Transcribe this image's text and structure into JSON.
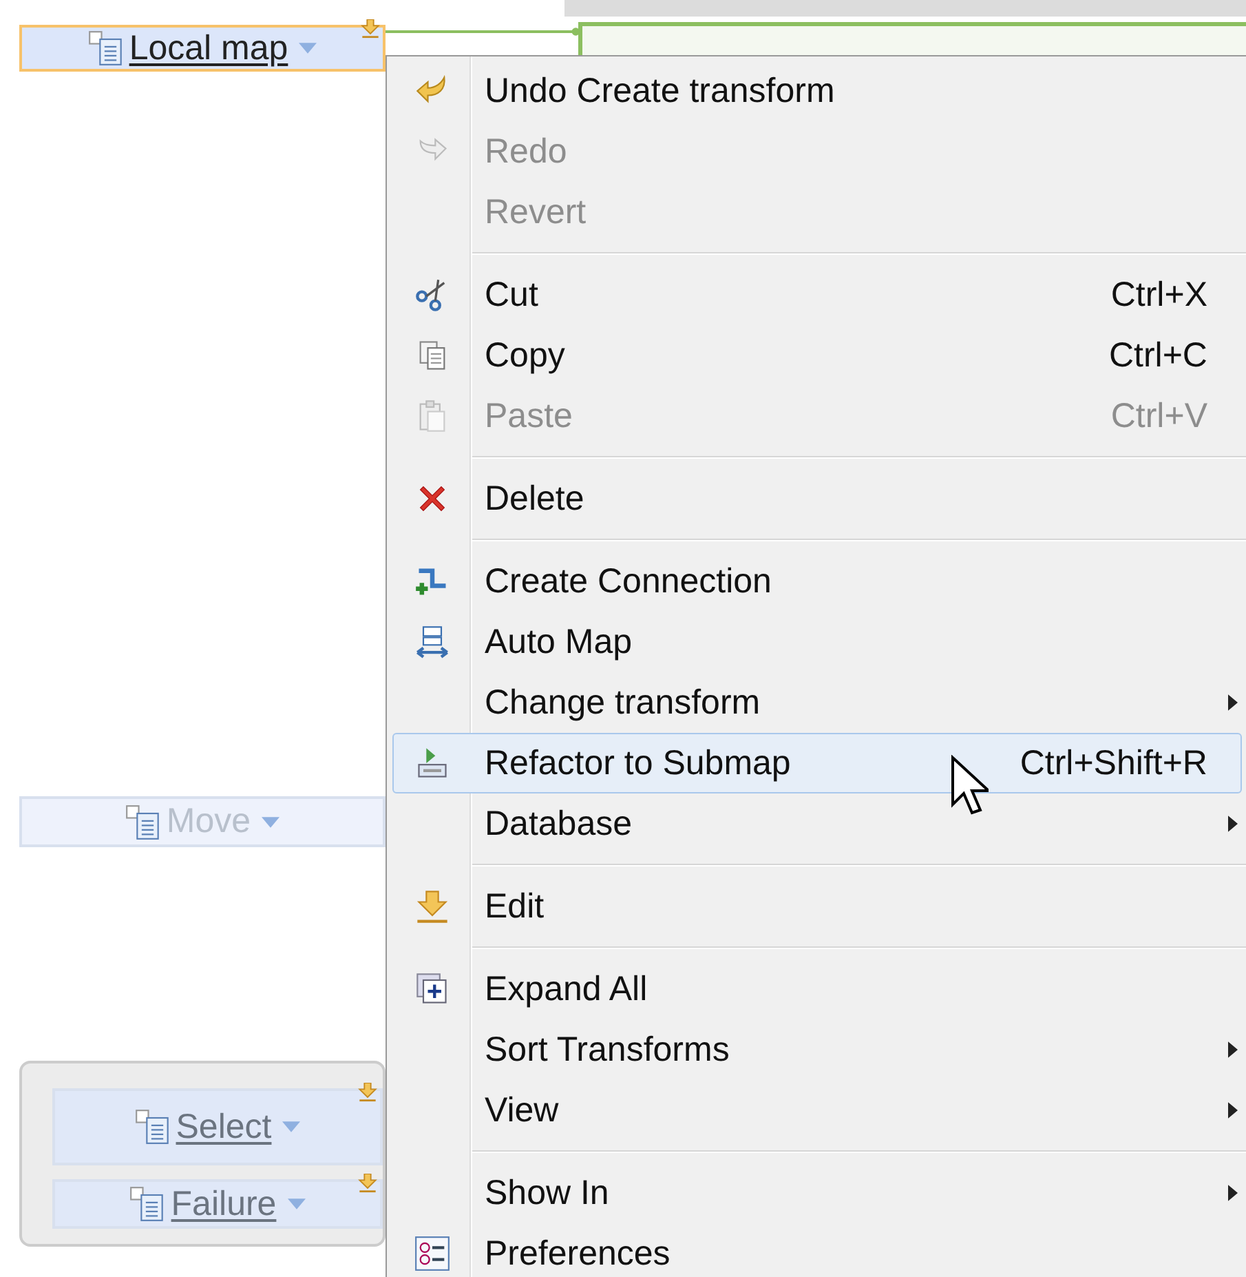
{
  "nodes": [
    {
      "label": "Local map",
      "selected": true,
      "disabled": false,
      "grouped": false
    },
    {
      "label": "Move",
      "selected": false,
      "disabled": true,
      "grouped": false
    },
    {
      "label": "Select",
      "selected": false,
      "disabled": false,
      "grouped": true
    },
    {
      "label": "Failure",
      "selected": false,
      "disabled": false,
      "grouped": true
    }
  ],
  "menu": {
    "items": [
      {
        "kind": "item",
        "label": "Undo Create transform",
        "disabled": false,
        "selected": false,
        "submenu": false
      },
      {
        "kind": "item",
        "label": "Redo",
        "disabled": true,
        "selected": false,
        "submenu": false
      },
      {
        "kind": "item",
        "label": "Revert",
        "disabled": true,
        "selected": false,
        "submenu": false
      },
      {
        "kind": "separator"
      },
      {
        "kind": "item",
        "label": "Cut",
        "shortcut": "Ctrl+X",
        "disabled": false,
        "selected": false,
        "submenu": false
      },
      {
        "kind": "item",
        "label": "Copy",
        "shortcut": "Ctrl+C",
        "disabled": false,
        "selected": false,
        "submenu": false
      },
      {
        "kind": "item",
        "label": "Paste",
        "shortcut": "Ctrl+V",
        "disabled": true,
        "selected": false,
        "submenu": false
      },
      {
        "kind": "separator"
      },
      {
        "kind": "item",
        "label": "Delete",
        "disabled": false,
        "selected": false,
        "submenu": false
      },
      {
        "kind": "separator"
      },
      {
        "kind": "item",
        "label": "Create Connection",
        "disabled": false,
        "selected": false,
        "submenu": false
      },
      {
        "kind": "item",
        "label": "Auto Map",
        "disabled": false,
        "selected": false,
        "submenu": false
      },
      {
        "kind": "item",
        "label": "Change transform",
        "disabled": false,
        "selected": false,
        "submenu": true
      },
      {
        "kind": "item",
        "label": "Refactor to Submap",
        "shortcut": "Ctrl+Shift+R",
        "disabled": false,
        "selected": true,
        "submenu": false
      },
      {
        "kind": "item",
        "label": "Database",
        "disabled": false,
        "selected": false,
        "submenu": true
      },
      {
        "kind": "separator"
      },
      {
        "kind": "item",
        "label": "Edit",
        "disabled": false,
        "selected": false,
        "submenu": false
      },
      {
        "kind": "separator"
      },
      {
        "kind": "item",
        "label": "Expand All",
        "disabled": false,
        "selected": false,
        "submenu": false
      },
      {
        "kind": "item",
        "label": "Sort Transforms",
        "disabled": false,
        "selected": false,
        "submenu": true
      },
      {
        "kind": "item",
        "label": "View",
        "disabled": false,
        "selected": false,
        "submenu": true
      },
      {
        "kind": "separator"
      },
      {
        "kind": "item",
        "label": "Show In",
        "disabled": false,
        "selected": false,
        "submenu": true
      },
      {
        "kind": "item",
        "label": "Preferences",
        "disabled": false,
        "selected": false,
        "submenu": false
      }
    ]
  }
}
